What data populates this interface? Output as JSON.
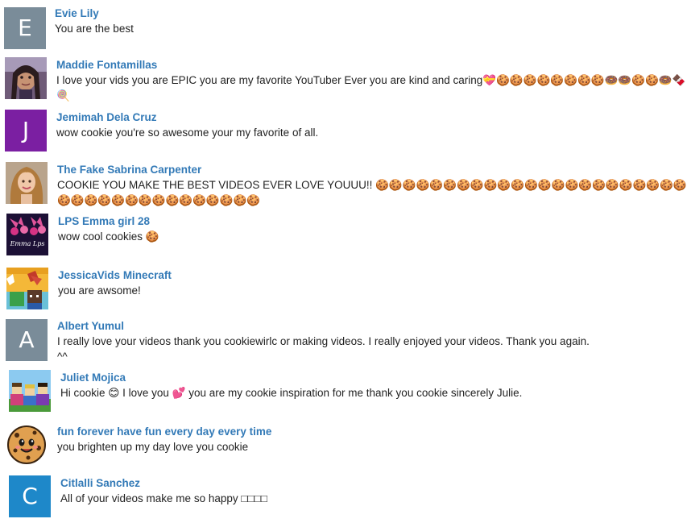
{
  "comments": [
    {
      "author": "Evie Lily",
      "text": "You are the best",
      "avatar": {
        "kind": "letter",
        "letter": "E",
        "color": "#7a8c99"
      }
    },
    {
      "author": "Maddie Fontamillas",
      "text": "I love your vids you are EPIC you are my favorite YouTuber Ever you are kind and caring💝🍪🍪🍪🍪🍪🍪🍪🍪🍩🍩🍪🍪🍩🍫🍭",
      "avatar": {
        "kind": "photo",
        "icon": "selfie-photo"
      }
    },
    {
      "author": "Jemimah Dela Cruz",
      "text": "wow cookie you're so awesome your my favorite of all.",
      "avatar": {
        "kind": "letter",
        "letter": "J",
        "color": "#7b1fa2"
      }
    },
    {
      "author": "The Fake Sabrina Carpenter",
      "text": "COOKIE YOU MAKE THE BEST VIDEOS EVER LOVE YOUUU!! 🍪🍪🍪🍪🍪🍪🍪🍪🍪🍪🍪🍪🍪🍪🍪🍪🍪🍪🍪🍪🍪🍪🍪🍪🍪🍪🍪🍪🍪🍪🍪🍪🍪🍪🍪🍪🍪🍪",
      "avatar": {
        "kind": "photo",
        "icon": "portrait-photo"
      }
    },
    {
      "author": "LPS Emma girl 28",
      "text": "wow cool cookies 🍪",
      "avatar": {
        "kind": "photo",
        "icon": "lps-emma-logo",
        "caption": "Emma Lps"
      }
    },
    {
      "author": "JessicaVids Minecraft",
      "text": "you are awsome!",
      "avatar": {
        "kind": "photo",
        "icon": "minecraft-art"
      }
    },
    {
      "author": "Albert Yumul",
      "text": "I really love your videos thank you cookiewirlc or making videos. I really enjoyed your videos. Thank you again.\n^^",
      "avatar": {
        "kind": "letter",
        "letter": "A",
        "color": "#7a8c99"
      }
    },
    {
      "author": "Juliet Mojica",
      "text": "Hi cookie 😊 I love you 💕 you are my cookie inspiration for me thank you cookie sincerely Julie.",
      "avatar": {
        "kind": "photo",
        "icon": "roblox-art"
      }
    },
    {
      "author": "fun forever have fun every day every time",
      "text": "you brighten up my day love you cookie",
      "avatar": {
        "kind": "photo",
        "icon": "cookie-character"
      }
    },
    {
      "author": "Citlalli Sanchez",
      "text": "All of your videos make me so happy □□□□",
      "avatar": {
        "kind": "letter",
        "letter": "C",
        "color": "#1e88c9"
      }
    }
  ]
}
